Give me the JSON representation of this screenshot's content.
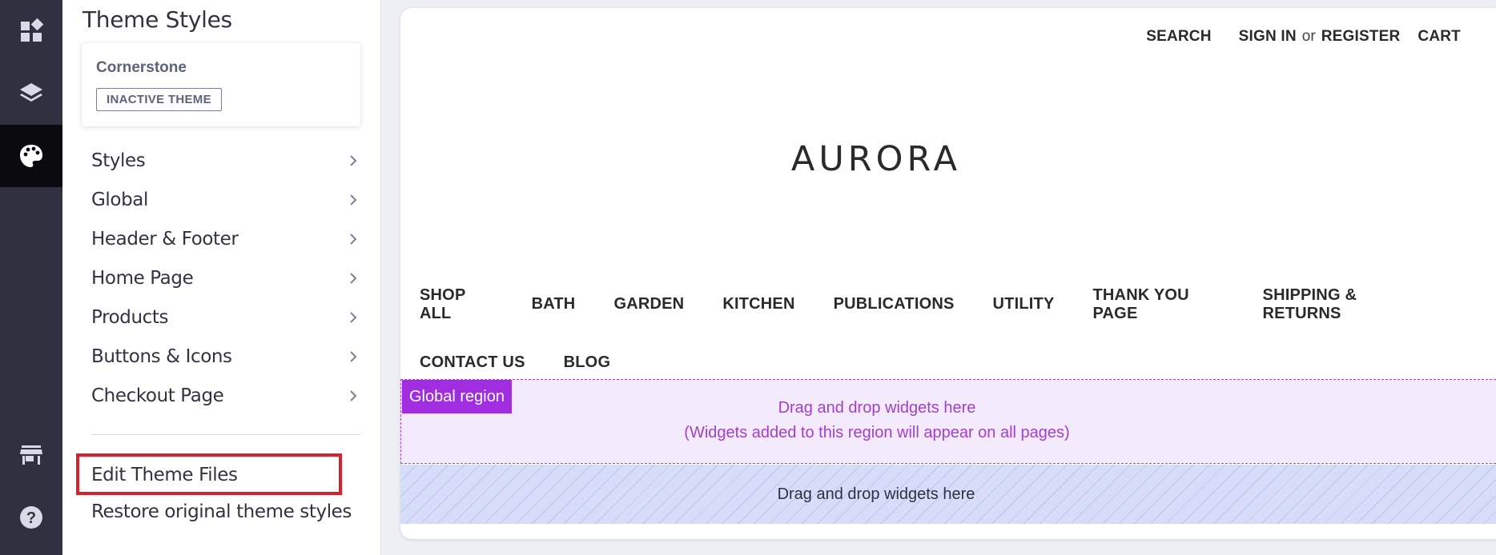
{
  "sidebar": {
    "title": "Theme Styles",
    "theme": {
      "name": "Cornerstone",
      "status": "INACTIVE THEME"
    },
    "items": [
      {
        "label": "Styles"
      },
      {
        "label": "Global"
      },
      {
        "label": "Header & Footer"
      },
      {
        "label": "Home Page"
      },
      {
        "label": "Products"
      },
      {
        "label": "Buttons & Icons"
      },
      {
        "label": "Checkout Page"
      }
    ],
    "edit_files": "Edit Theme Files",
    "restore": "Restore original theme styles"
  },
  "rail": {
    "icons": [
      "dashboard-icon",
      "layers-icon",
      "palette-icon",
      "storefront-icon",
      "help-icon"
    ],
    "active": "palette-icon"
  },
  "preview": {
    "top_nav": {
      "search": "SEARCH",
      "sign_in": "SIGN IN",
      "or": "or",
      "register": "REGISTER",
      "cart": "CART"
    },
    "logo": "AURORA",
    "categories_row1": [
      "SHOP ALL",
      "BATH",
      "GARDEN",
      "KITCHEN",
      "PUBLICATIONS",
      "UTILITY",
      "THANK YOU PAGE",
      "SHIPPING & RETURNS"
    ],
    "categories_row2": [
      "CONTACT US",
      "BLOG"
    ],
    "global_region": {
      "label": "Global region",
      "line1": "Drag and drop widgets here",
      "line2": "(Widgets added to this region will appear on all pages)"
    },
    "drop_region": {
      "text": "Drag and drop widgets here"
    }
  },
  "colors": {
    "rail_bg": "#2f3140",
    "highlight_border": "#d7212d",
    "global_region_label": "#a12de0",
    "global_region_text": "#a23fd0",
    "drop_region_bg": "#d7dcf8"
  }
}
